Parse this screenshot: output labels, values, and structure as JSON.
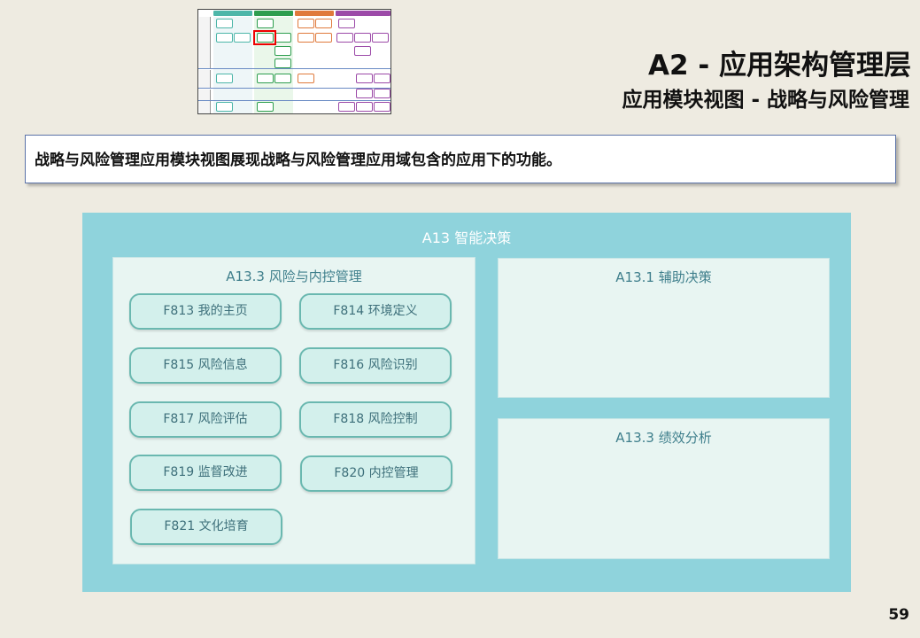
{
  "header": {
    "title": "A2 - 应用架构管理层",
    "subtitle": "应用模块视图 - 战略与风险管理"
  },
  "description": "战略与风险管理应用模块视图展现战略与风险管理应用域包含的应用下的功能。",
  "domain": {
    "title": "A13 智能决策",
    "panels": {
      "risk": {
        "title": "A13.3 风险与内控管理",
        "functions": [
          {
            "label": "F813  我的主页"
          },
          {
            "label": "F814  环境定义"
          },
          {
            "label": "F815  风险信息"
          },
          {
            "label": "F816  风险识别"
          },
          {
            "label": "F817  风险评估"
          },
          {
            "label": "F818  风险控制"
          },
          {
            "label": "F819  监督改进"
          },
          {
            "label": "F820  内控管理"
          },
          {
            "label": "F821  文化培育"
          }
        ]
      },
      "aux": {
        "title": "A13.1 辅助决策"
      },
      "perf": {
        "title": "A13.3 绩效分析"
      }
    }
  },
  "page_number": "59",
  "colors": {
    "background": "#eeebe1",
    "domain_bg": "#8fd3dc",
    "panel_bg": "#e8f5f2",
    "function_bg": "#d3f0ec",
    "function_border": "#6ab8b0",
    "highlight": "#e00000"
  }
}
